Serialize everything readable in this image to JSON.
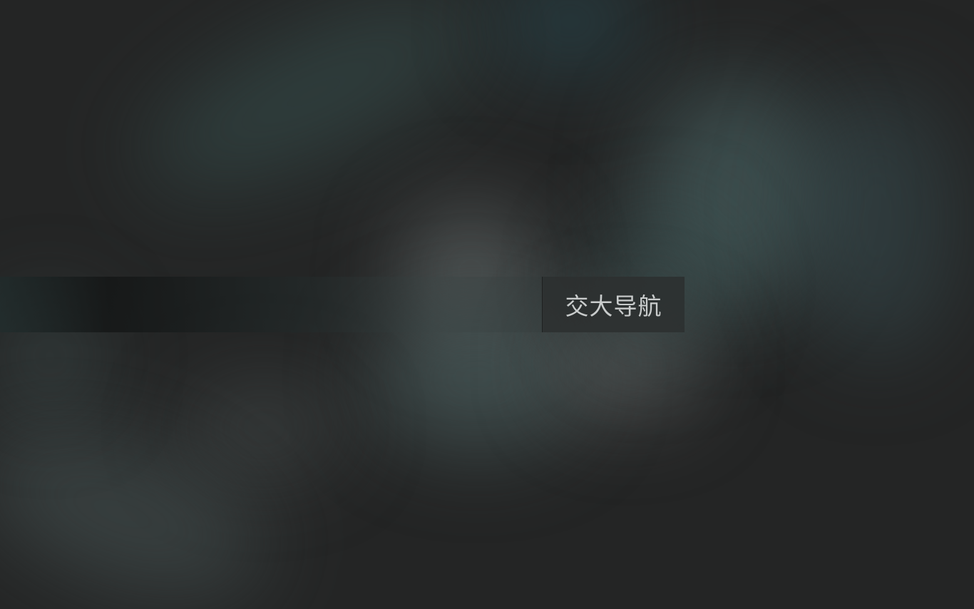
{
  "nav": {
    "button_label": "交大导航"
  },
  "colors": {
    "background": "#242525",
    "nav_button_bg": "#2c3030",
    "nav_button_text": "#c9cccc"
  }
}
